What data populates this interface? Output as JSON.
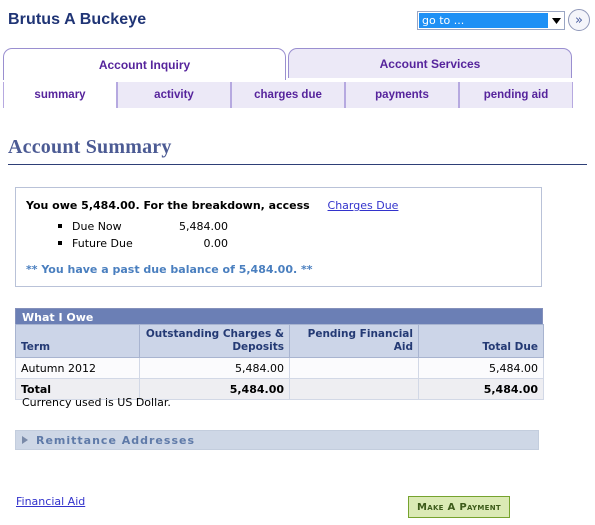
{
  "header": {
    "user_name": "Brutus A Buckeye",
    "goto_value": "go to ...",
    "goto_button_icon": "double-chevron-right-icon"
  },
  "tabs": [
    {
      "label": "Account Inquiry",
      "active": true
    },
    {
      "label": "Account Services",
      "active": false
    }
  ],
  "subtabs": [
    {
      "label": "summary",
      "active": true
    },
    {
      "label": "activity",
      "active": false
    },
    {
      "label": "charges due",
      "active": false
    },
    {
      "label": "payments",
      "active": false
    },
    {
      "label": "pending aid",
      "active": false
    }
  ],
  "page": {
    "title": "Account Summary"
  },
  "summary_box": {
    "owe_text": "You owe 5,484.00.  For the breakdown, access",
    "charges_due_link": "Charges Due",
    "lines": [
      {
        "label": "Due Now",
        "amount": "5,484.00"
      },
      {
        "label": "Future Due",
        "amount": "0.00"
      }
    ],
    "past_due_message": "** You have a past due balance of 5,484.00. **"
  },
  "what_i_owe": {
    "caption": "What I Owe",
    "columns": [
      "Term",
      "Outstanding Charges & Deposits",
      "Pending Financial Aid",
      "Total Due"
    ],
    "rows": [
      {
        "term": "Autumn 2012",
        "outstanding": "5,484.00",
        "pending_aid": "",
        "total_due": "5,484.00"
      }
    ],
    "total_row": {
      "term": "Total",
      "outstanding": "5,484.00",
      "pending_aid": "",
      "total_due": "5,484.00"
    },
    "currency_note": "Currency used is US Dollar."
  },
  "remittance": {
    "label": "Remittance Addresses",
    "expanded": false,
    "toggle_icon": "triangle-right-icon"
  },
  "footer": {
    "financial_aid_link": "Financial Aid",
    "make_payment_button": "Make A Payment"
  },
  "colors": {
    "tab_text": "#56249c",
    "tab_inactive_bg": "#ece9f7",
    "title_text": "#4c5b94",
    "table_caption_bg": "#6b7fb5",
    "table_header_bg": "#ccd5e8",
    "link": "#3333cc",
    "past_due_text": "#4a7fbf",
    "pay_button_bg": "#dbeab5",
    "pay_button_border": "#76a32e",
    "goto_highlight": "#1e90f5"
  }
}
